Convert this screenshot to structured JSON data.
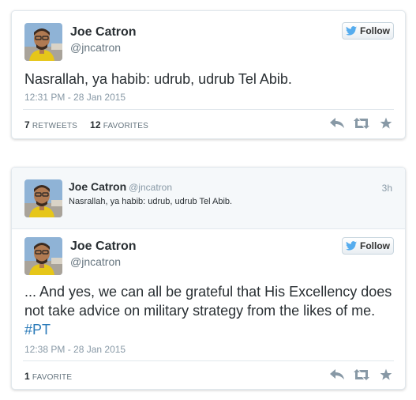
{
  "tweet1": {
    "name": "Joe Catron",
    "handle": "@jncatron",
    "follow_label": "Follow",
    "text": "Nasrallah, ya habib: udrub, udrub Tel Abib.",
    "timestamp": "12:31 PM - 28 Jan 2015",
    "retweets_count": "7",
    "retweets_label": "RETWEETS",
    "favorites_count": "12",
    "favorites_label": "FAVORITES"
  },
  "tweet2": {
    "quoted": {
      "name": "Joe Catron",
      "handle": "@jncatron",
      "text": "Nasrallah, ya habib: udrub, udrub Tel Abib.",
      "age": "3h"
    },
    "name": "Joe Catron",
    "handle": "@jncatron",
    "follow_label": "Follow",
    "text": "... And yes, we can all be grateful that His Excellency does not take advice on military strategy from the likes of me.",
    "hashtag": "#PT",
    "timestamp": "12:38 PM - 28 Jan 2015",
    "favorites_count": "1",
    "favorites_label": "FAVORITE"
  },
  "colors": {
    "link": "#2b7bb9",
    "twitter_blue": "#55acee",
    "muted": "#8899a6",
    "border": "#e1e8ed"
  },
  "icons": [
    "avatar-photo",
    "twitter-bird-icon",
    "reply-icon",
    "retweet-icon",
    "favorite-star-icon"
  ]
}
